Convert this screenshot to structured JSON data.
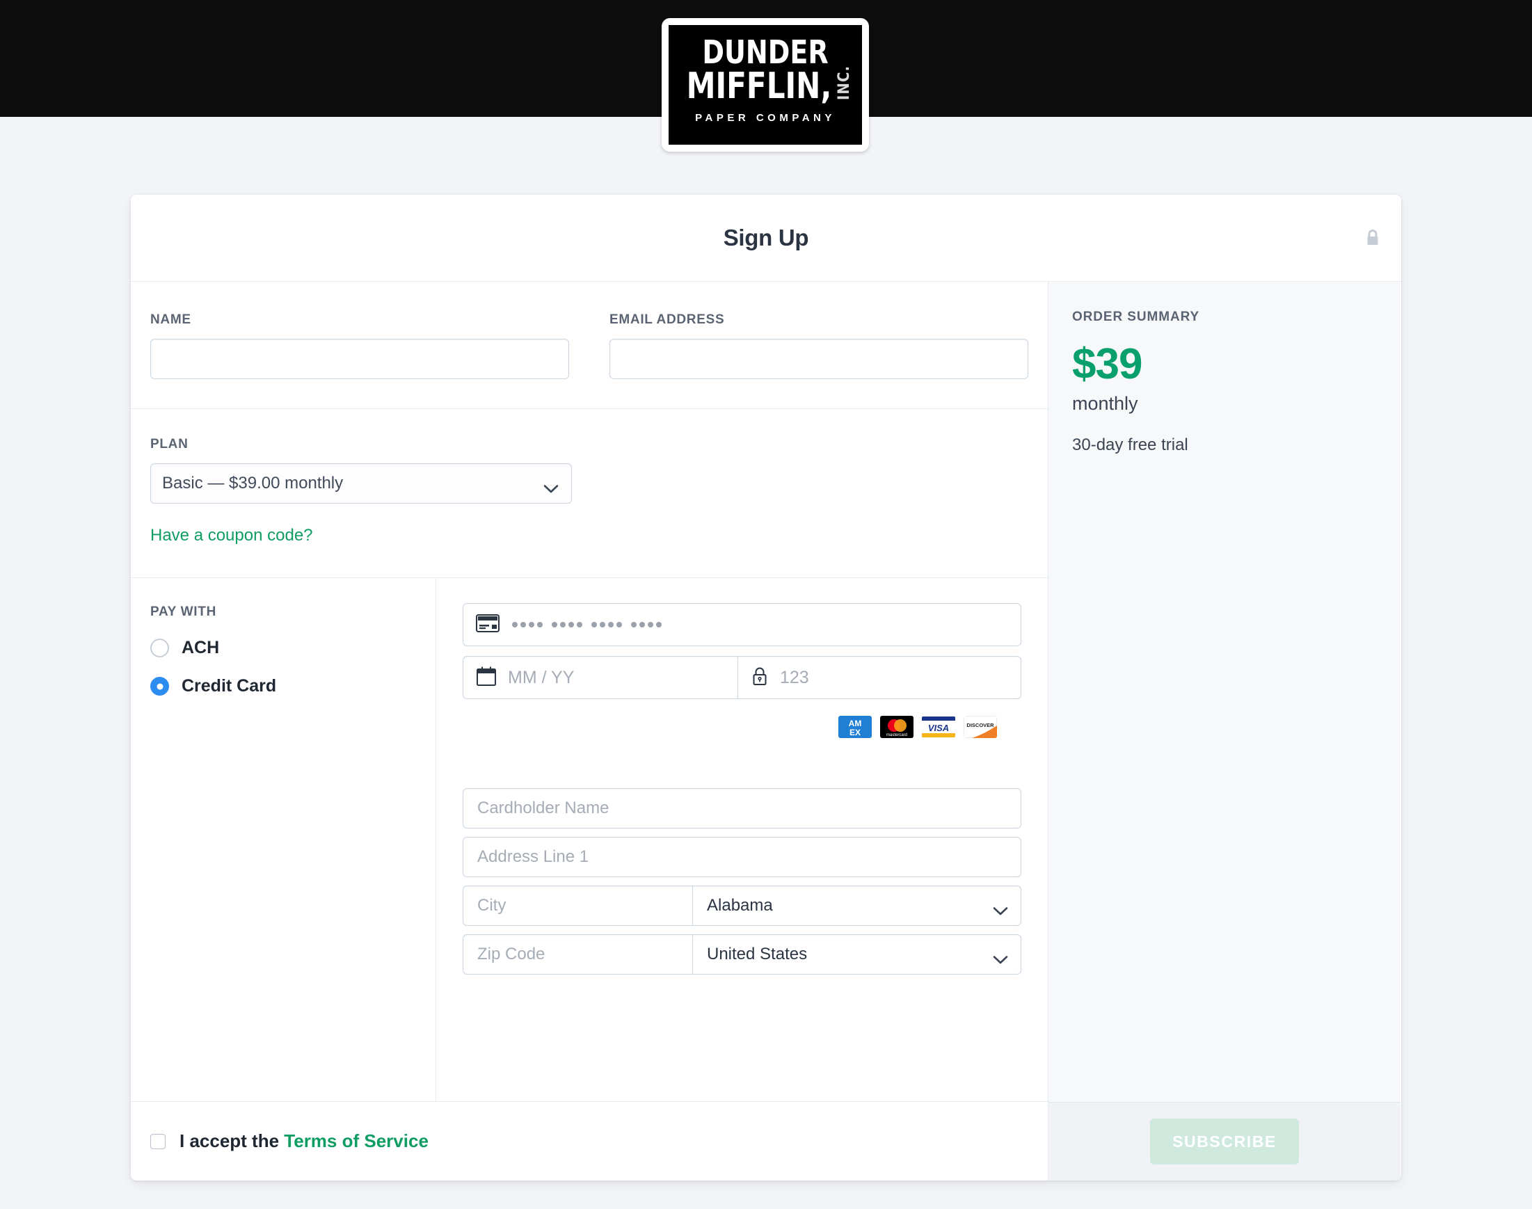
{
  "brand": {
    "logo_line1": "DUNDER",
    "logo_line2": "MIFFLIN,",
    "logo_inc": "INC.",
    "logo_line3": "PAPER COMPANY"
  },
  "header": {
    "title": "Sign Up",
    "lock_icon": "lock-icon"
  },
  "identity": {
    "name_label": "NAME",
    "name_value": "",
    "name_placeholder": "",
    "email_label": "EMAIL ADDRESS",
    "email_value": "",
    "email_placeholder": ""
  },
  "plan": {
    "label": "PLAN",
    "selected": "Basic — $39.00 monthly",
    "options": [
      "Basic — $39.00 monthly"
    ],
    "coupon_link": "Have a coupon code?"
  },
  "payment": {
    "label": "PAY WITH",
    "methods": [
      {
        "label": "ACH",
        "selected": false
      },
      {
        "label": "Credit Card",
        "selected": true
      }
    ],
    "card_number_placeholder": "•••• •••• •••• ••••",
    "card_number_value": "",
    "expiry_placeholder": "MM / YY",
    "expiry_value": "",
    "cvc_placeholder": "123",
    "cvc_value": "",
    "card_icon": "credit-card-icon",
    "calendar_icon": "calendar-icon",
    "cvc_lock_icon": "lock-icon",
    "brands": [
      "AMEX",
      "mastercard",
      "VISA",
      "DISCOVER"
    ],
    "brand_labels": {
      "amex_top": "AM",
      "amex_bottom": "EX",
      "mastercard": "mastercard",
      "visa": "VISA",
      "discover": "DISC VER"
    }
  },
  "billing": {
    "cardholder_placeholder": "Cardholder Name",
    "cardholder_value": "",
    "address1_placeholder": "Address Line 1",
    "address1_value": "",
    "city_placeholder": "City",
    "city_value": "",
    "state_selected": "Alabama",
    "zip_placeholder": "Zip Code",
    "zip_value": "",
    "country_selected": "United States"
  },
  "terms": {
    "accept_text": "I accept the ",
    "link_text": "Terms of Service",
    "checked": false
  },
  "summary": {
    "label": "ORDER SUMMARY",
    "price": "$39",
    "period": "monthly",
    "trial": "30-day free trial"
  },
  "actions": {
    "subscribe_label": "SUBSCRIBE"
  },
  "colors": {
    "accent_green": "#0f9d63",
    "price_green": "#0aa06e",
    "radio_blue": "#2d8cf0",
    "subscribe_disabled": "#cfe9de",
    "page_bg": "#f2f4f8",
    "topbar": "#0d0d0e"
  }
}
